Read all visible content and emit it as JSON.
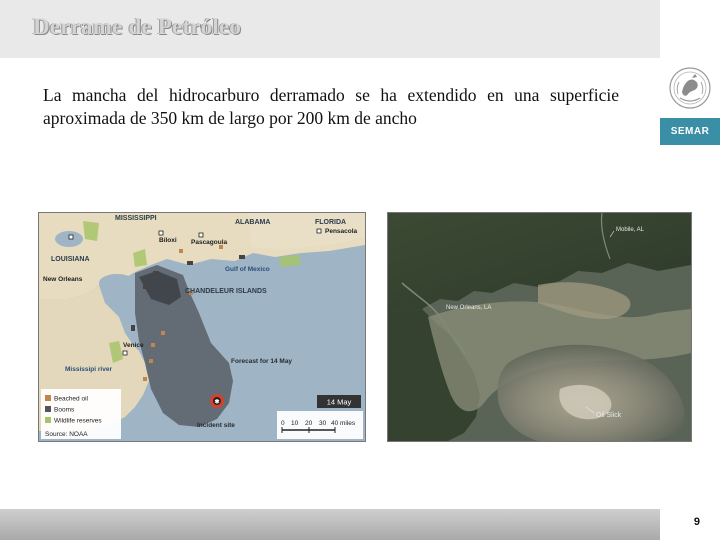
{
  "slide": {
    "title": "Derrame de Petróleo",
    "body": "La mancha del hidrocarburo derramado se ha extendido en una superficie aproximada de 350 km de largo por 200 km de ancho",
    "page_number": "9"
  },
  "logo": {
    "label": "SEMAR",
    "band_color": "#3a8ea6"
  },
  "map_left": {
    "states": [
      "MISSISSIPPI",
      "ALABAMA",
      "FLORIDA",
      "LOUISIANA"
    ],
    "cities": [
      "Biloxi",
      "Pascagoula",
      "Pensacola",
      "New Orleans",
      "Venice"
    ],
    "water_labels": [
      "Gulf of Mexico",
      "Mississipi river"
    ],
    "islands": "CHANDELEUR ISLANDS",
    "forecast": "Forecast for 14 May",
    "date_badge": "14 May",
    "incident": "Incident site",
    "legend": [
      "Beached oil",
      "Booms",
      "Wildlife reserves"
    ],
    "legend_colors": [
      "#c0874b",
      "#555555",
      "#a7c46a"
    ],
    "scale_ticks": [
      "0",
      "10",
      "20",
      "30",
      "40"
    ],
    "scale_unit": "miles",
    "source": "Source: NOAA"
  },
  "map_right": {
    "labels": [
      "Mobile, AL",
      "New Orleans, LA",
      "Oil Slick"
    ]
  }
}
